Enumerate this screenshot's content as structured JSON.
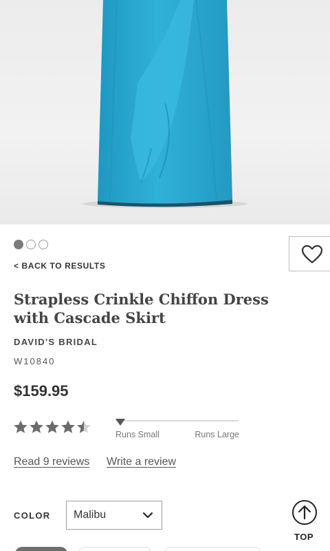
{
  "product": {
    "image_alt": "Strapless Crinkle Chiffon Dress with Cascade Skirt",
    "carousel": {
      "total": 3,
      "active": 1
    },
    "back_label": "< BACK TO RESULTS",
    "title": "Strapless Crinkle Chiffon Dress with Cascade Skirt",
    "brand": "DAVID'S BRIDAL",
    "sku": "W10840",
    "price": "$159.95",
    "rating": {
      "value": 4.5,
      "max": 5
    },
    "fit": {
      "left_label": "Runs Small",
      "right_label": "Runs Large",
      "position": 0.0
    },
    "reviews": {
      "read_label": "Read 9 reviews",
      "write_label": "Write a review"
    }
  },
  "color": {
    "label": "COLOR",
    "selected": "Malibu",
    "dress_color": "#2aa8cf"
  },
  "top_button": {
    "label": "TOP"
  }
}
